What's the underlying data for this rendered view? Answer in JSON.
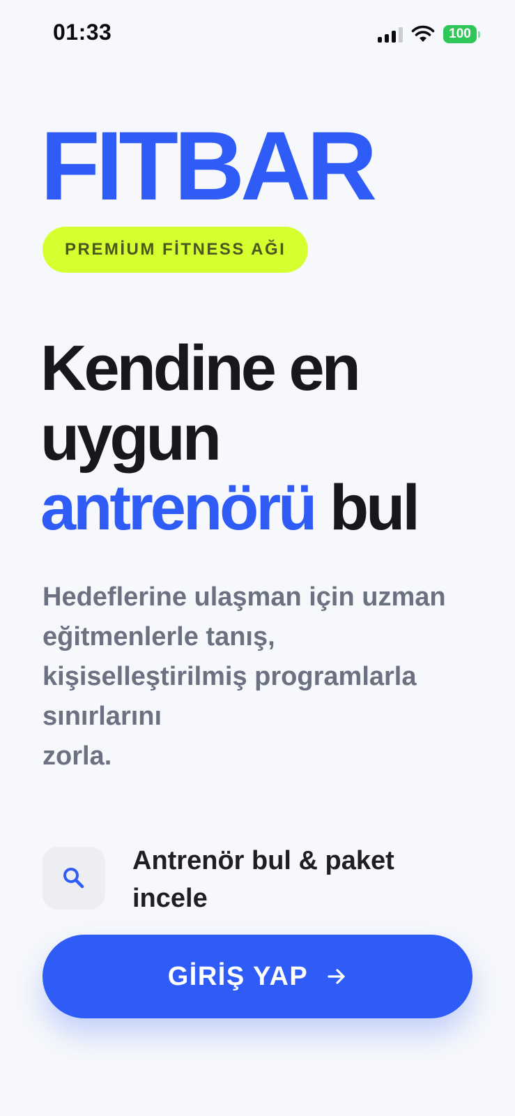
{
  "status_bar": {
    "time": "01:33",
    "battery": "100",
    "icons": [
      "signal-icon",
      "wifi-icon",
      "battery-icon"
    ],
    "battery_color": "#30c759"
  },
  "brand": {
    "name": "FITBAR",
    "tagline": "PREMİUM FİTNESS AĞI"
  },
  "headline": {
    "line1": "Kendine en",
    "line2": "uygun",
    "accent": "antrenörü",
    "end": "bul"
  },
  "description": {
    "line1": "Hedeflerine ulaşman için uzman",
    "line2": "eğitmenlerle tanış,",
    "line3": "kişiselleştirilmiş programlarla",
    "line4": "sınırlarını",
    "line5": "zorla."
  },
  "feature": {
    "icon": "search-icon",
    "line1": "Antrenör bul & paket",
    "line2": "incele"
  },
  "cta": {
    "label": "GİRİŞ YAP",
    "icon": "arrow-right-icon"
  },
  "colors": {
    "accent": "#2f5bf7",
    "badge": "#d5ff2e",
    "background": "#f6f8fb",
    "text": "#17181c",
    "muted_text": "#6b7180"
  }
}
